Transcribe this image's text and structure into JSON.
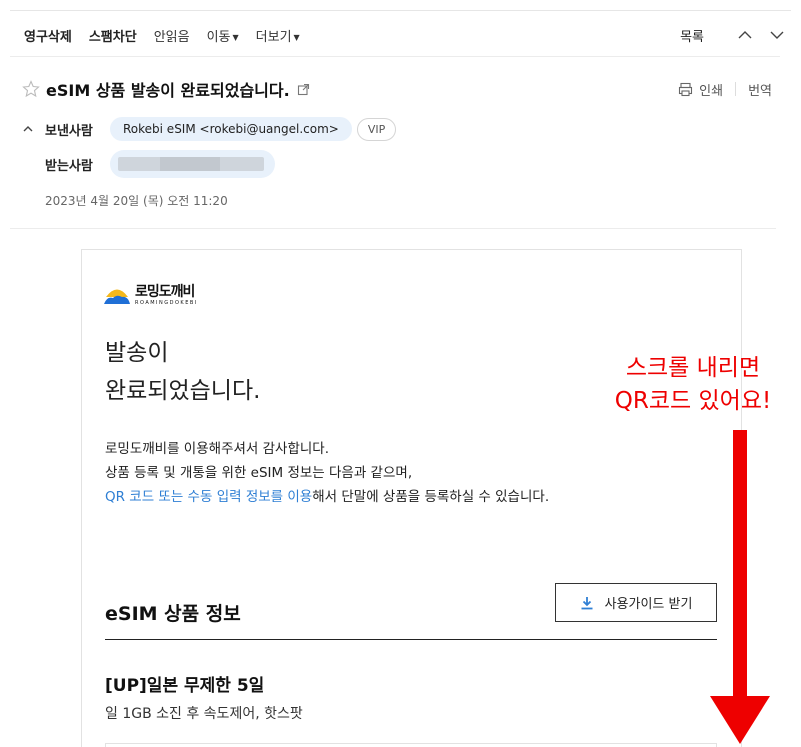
{
  "toolbar": {
    "archive": "영구삭제",
    "block_spam": "스팸차단",
    "mark_unread": "안읽음",
    "move": "이동",
    "more": "더보기",
    "list": "목록"
  },
  "mail": {
    "subject": "eSIM 상품 발송이 완료되었습니다.",
    "print": "인쇄",
    "translate": "번역",
    "from_label": "보낸사람",
    "from_value": "Rokebi eSIM <rokebi@uangel.com>",
    "vip": "VIP",
    "to_label": "받는사람",
    "date": "2023년 4월 20일 (목) 오전 11:20"
  },
  "body": {
    "logo_name": "로밍도깨비",
    "logo_sub": "ROAMINGDOKEBI",
    "headline_line1": "발송이",
    "headline_line2": "완료되었습니다.",
    "intro_line1": "로밍도깨비를 이용해주셔서 감사합니다.",
    "intro_line2": "상품 등록 및 개통을 위한 eSIM 정보는 다음과 같으며,",
    "intro_link": "QR 코드 또는 수동 입력 정보를 이용",
    "intro_line3_rest": "해서 단말에 상품을 등록하실 수 있습니다.",
    "section_title": "eSIM 상품 정보",
    "guide_button": "사용가이드 받기",
    "product_name": "[UP]일본 무제한 5일",
    "product_desc": "일 1GB 소진 후 속도제어, 핫스팟"
  },
  "annotation": {
    "line1": "스크롤 내리면",
    "line2": "QR코드 있어요!",
    "color": "#ee0000"
  },
  "colors": {
    "link": "#2f7fd4",
    "chip": "#e8f1fb"
  }
}
